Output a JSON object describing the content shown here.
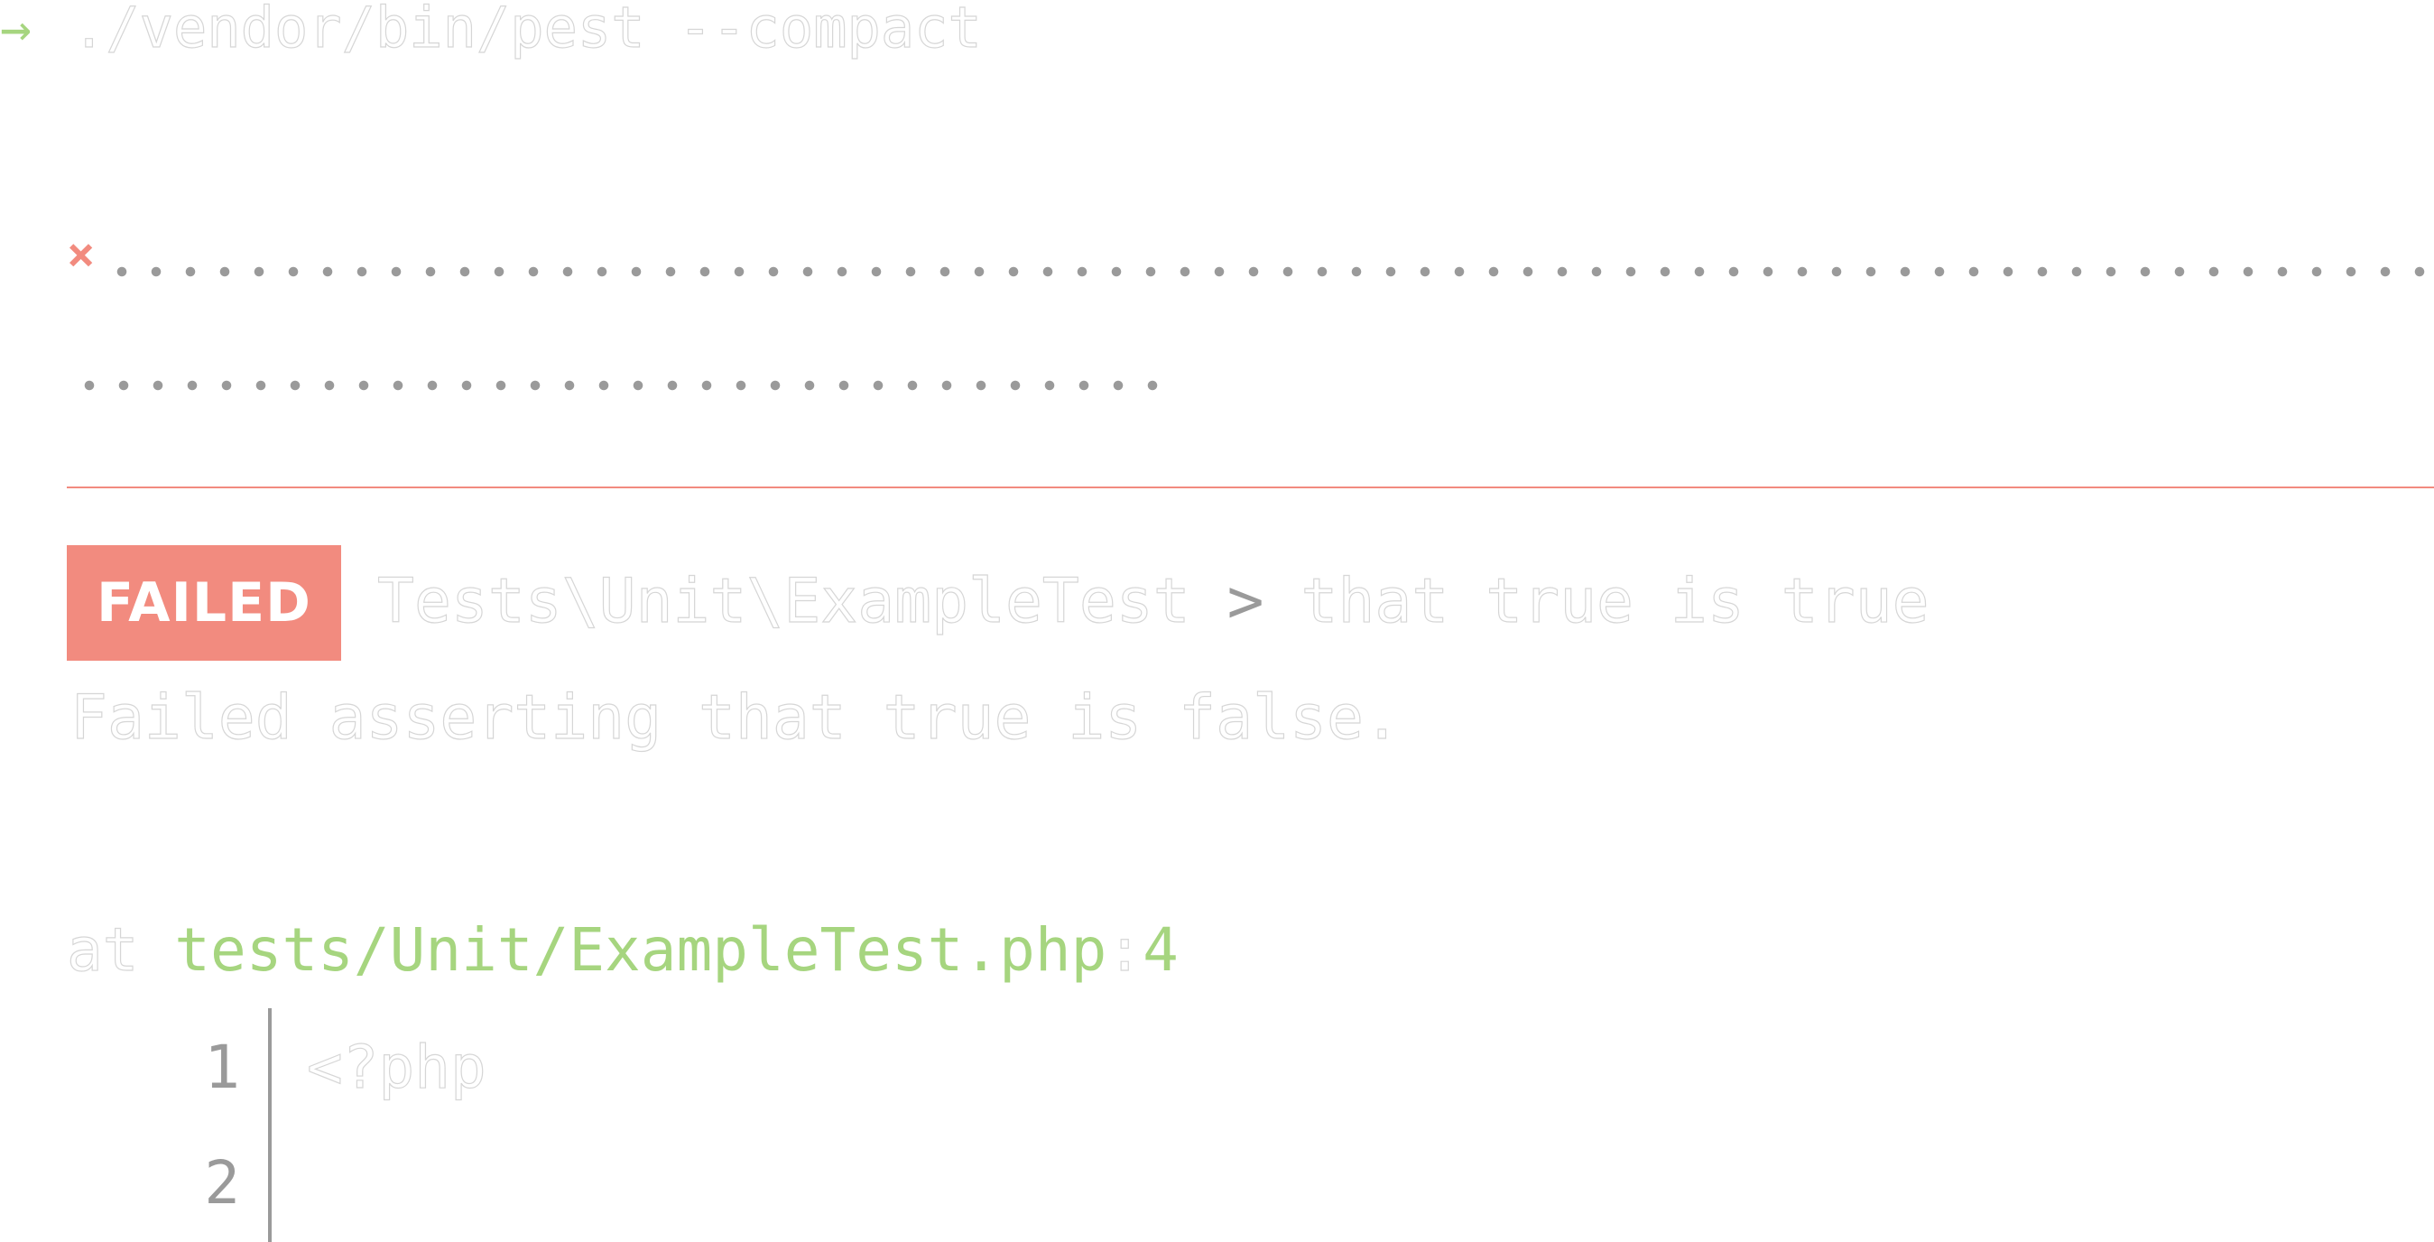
{
  "prompt": {
    "arrow": "→",
    "command": "./vendor/bin/pest --compact"
  },
  "progress": {
    "fail_marker": "×"
  },
  "failure": {
    "badge": "FAILED",
    "test_class": "Tests\\Unit\\ExampleTest",
    "separator": ">",
    "test_name": "that true is true",
    "message": "Failed asserting that true is false."
  },
  "location": {
    "at": "at",
    "path": "tests/Unit/ExampleTest.php",
    "colon": ":",
    "line": "4"
  },
  "code": {
    "lines": [
      {
        "number": "1",
        "text": "<?php"
      },
      {
        "number": "2",
        "text": ""
      }
    ]
  },
  "colors": {
    "success": "#a6d57f",
    "error": "#f28b7f",
    "muted": "#9a9a9a"
  }
}
